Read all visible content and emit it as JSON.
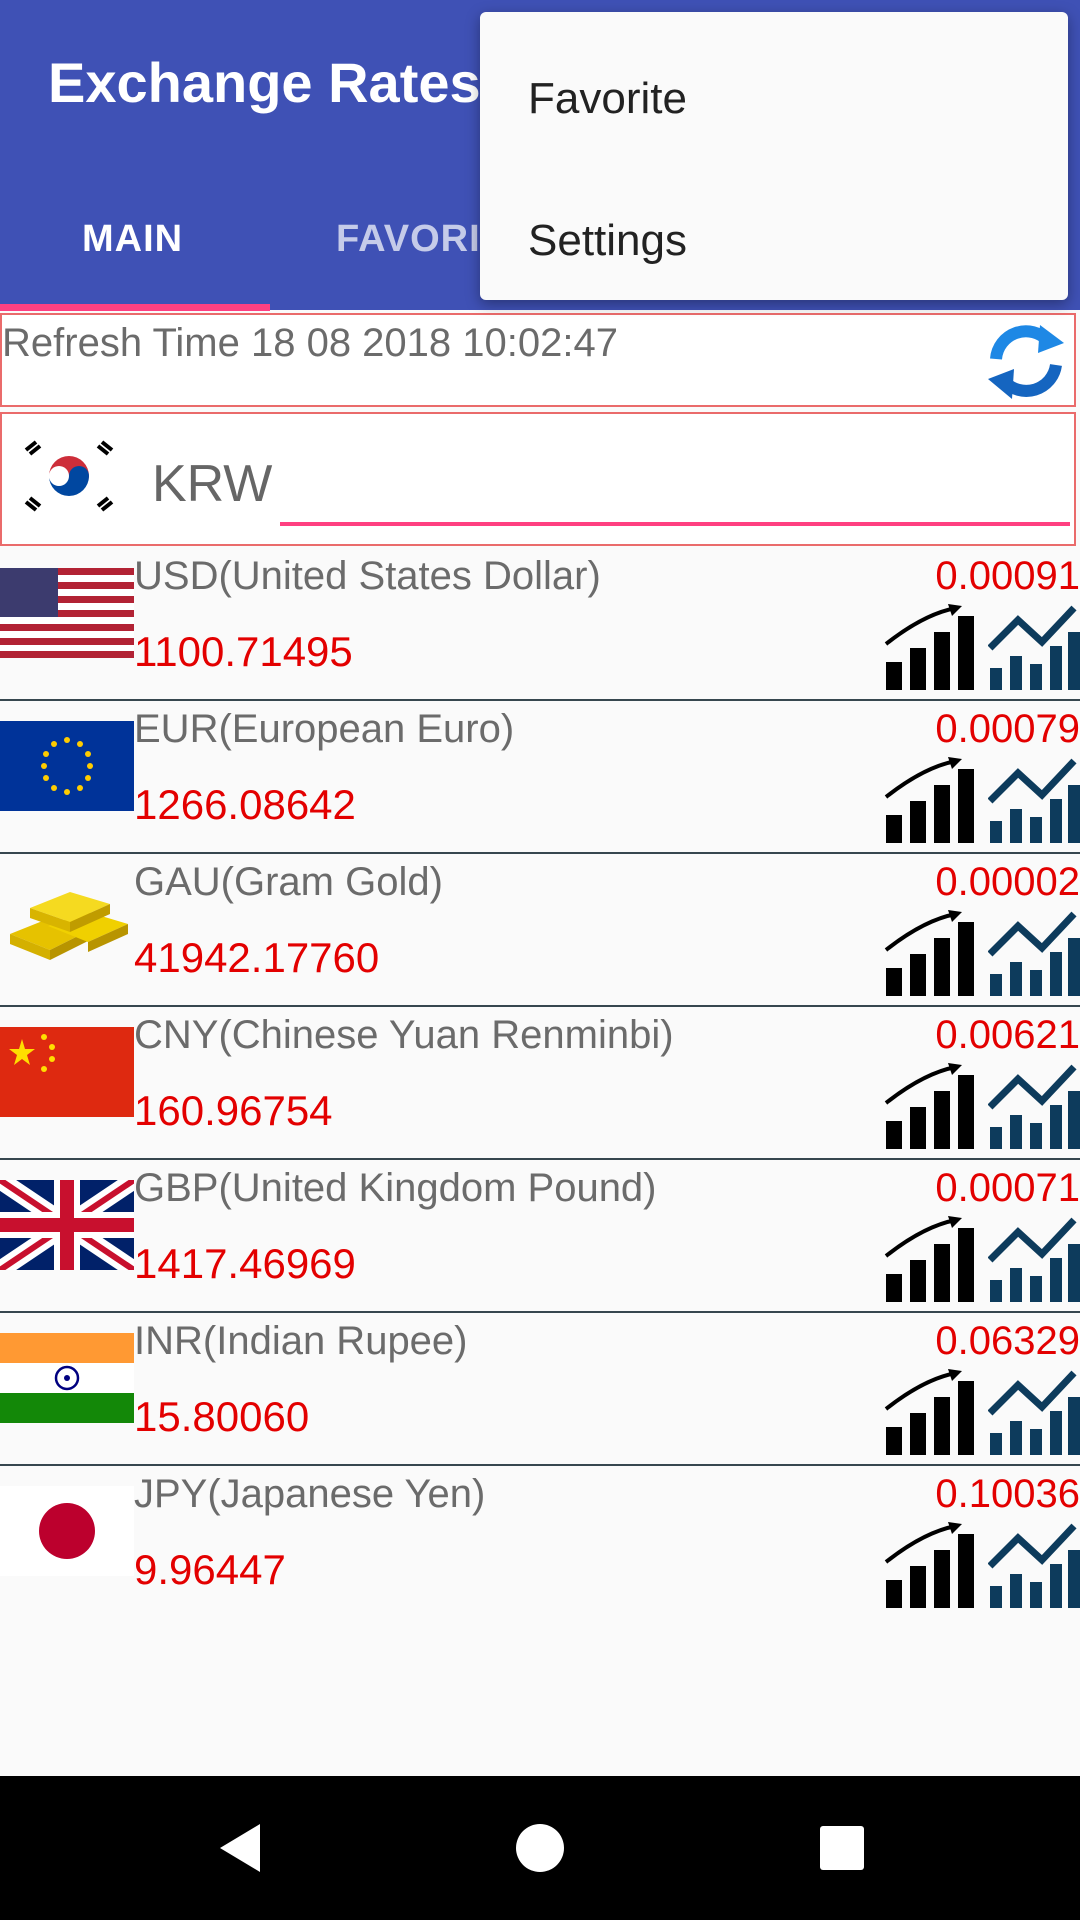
{
  "app": {
    "title": "Exchange Rates"
  },
  "tabs": [
    {
      "label": "MAIN",
      "selected": true
    },
    {
      "label": "FAVORI",
      "selected": false
    }
  ],
  "menu": {
    "items": [
      "Favorite",
      "Settings"
    ]
  },
  "refresh": {
    "text": "Refresh Time 18 08 2018 10:02:47",
    "icon": "refresh-icon"
  },
  "base_currency": {
    "code": "KRW",
    "flag": "south-korea-flag"
  },
  "currencies": [
    {
      "name": "USD(United States Dollar)",
      "rate": "1100.71495",
      "inverse": "0.00091",
      "flag": "us-flag"
    },
    {
      "name": "EUR(European Euro)",
      "rate": "1266.08642",
      "inverse": "0.00079",
      "flag": "eu-flag"
    },
    {
      "name": "GAU(Gram Gold)",
      "rate": "41942.17760",
      "inverse": "0.00002",
      "flag": "gold-bars"
    },
    {
      "name": "CNY(Chinese Yuan Renminbi)",
      "rate": "160.96754",
      "inverse": "0.00621",
      "flag": "china-flag"
    },
    {
      "name": "GBP(United Kingdom Pound)",
      "rate": "1417.46969",
      "inverse": "0.00071",
      "flag": "uk-flag"
    },
    {
      "name": "INR(Indian Rupee)",
      "rate": "15.80060",
      "inverse": "0.06329",
      "flag": "india-flag"
    },
    {
      "name": "JPY(Japanese Yen)",
      "rate": "9.96447",
      "inverse": "0.10036",
      "flag": "japan-flag"
    }
  ],
  "colors": {
    "primary": "#3f51b5",
    "accent": "#ff4081",
    "rate_red": "#e30000",
    "border_red": "#ea6b6b"
  },
  "navbar": {
    "buttons": [
      "back",
      "home",
      "recents"
    ]
  }
}
